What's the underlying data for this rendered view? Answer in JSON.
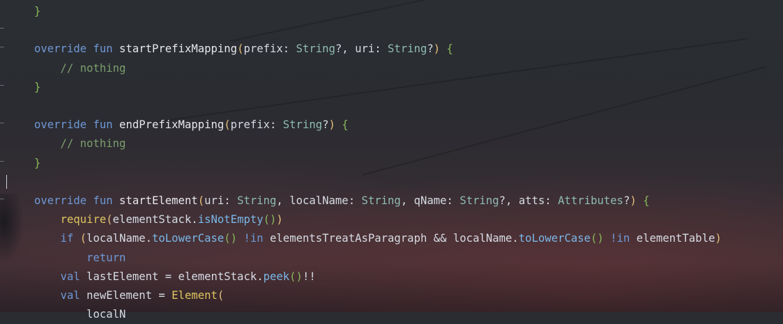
{
  "editor": {
    "lines": [
      {
        "tokens": [
          {
            "t": "}",
            "c": "brace"
          }
        ]
      },
      {
        "tokens": []
      },
      {
        "tokens": [
          {
            "t": "override",
            "c": "kw"
          },
          {
            "t": " ",
            "c": "plain"
          },
          {
            "t": "fun",
            "c": "kw"
          },
          {
            "t": " startPrefixMapping",
            "c": "fn"
          },
          {
            "t": "(",
            "c": "paren"
          },
          {
            "t": "prefix: ",
            "c": "plain"
          },
          {
            "t": "String",
            "c": "type"
          },
          {
            "t": "?, uri: ",
            "c": "plain"
          },
          {
            "t": "String",
            "c": "type"
          },
          {
            "t": "?",
            "c": "plain"
          },
          {
            "t": ")",
            "c": "paren"
          },
          {
            "t": " ",
            "c": "plain"
          },
          {
            "t": "{",
            "c": "brace"
          }
        ]
      },
      {
        "tokens": [
          {
            "t": "    // nothing",
            "c": "cmt"
          }
        ]
      },
      {
        "tokens": [
          {
            "t": "}",
            "c": "brace"
          }
        ]
      },
      {
        "tokens": []
      },
      {
        "tokens": [
          {
            "t": "override",
            "c": "kw"
          },
          {
            "t": " ",
            "c": "plain"
          },
          {
            "t": "fun",
            "c": "kw"
          },
          {
            "t": " endPrefixMapping",
            "c": "fn"
          },
          {
            "t": "(",
            "c": "paren"
          },
          {
            "t": "prefix: ",
            "c": "plain"
          },
          {
            "t": "String",
            "c": "type"
          },
          {
            "t": "?",
            "c": "plain"
          },
          {
            "t": ")",
            "c": "paren"
          },
          {
            "t": " ",
            "c": "plain"
          },
          {
            "t": "{",
            "c": "brace"
          }
        ]
      },
      {
        "tokens": [
          {
            "t": "    // nothing",
            "c": "cmt"
          }
        ]
      },
      {
        "tokens": [
          {
            "t": "}",
            "c": "brace"
          }
        ]
      },
      {
        "tokens": []
      },
      {
        "tokens": [
          {
            "t": "override",
            "c": "kw"
          },
          {
            "t": " ",
            "c": "plain"
          },
          {
            "t": "fun",
            "c": "kw"
          },
          {
            "t": " startElement",
            "c": "fn"
          },
          {
            "t": "(",
            "c": "paren"
          },
          {
            "t": "uri: ",
            "c": "plain"
          },
          {
            "t": "String",
            "c": "type"
          },
          {
            "t": ", localName: ",
            "c": "plain"
          },
          {
            "t": "String",
            "c": "type"
          },
          {
            "t": ", qName: ",
            "c": "plain"
          },
          {
            "t": "String",
            "c": "type"
          },
          {
            "t": "?, atts: ",
            "c": "plain"
          },
          {
            "t": "Attributes",
            "c": "type"
          },
          {
            "t": "?",
            "c": "plain"
          },
          {
            "t": ")",
            "c": "paren"
          },
          {
            "t": " ",
            "c": "plain"
          },
          {
            "t": "{",
            "c": "brace"
          }
        ]
      },
      {
        "tokens": [
          {
            "t": "    ",
            "c": "plain"
          },
          {
            "t": "require",
            "c": "call"
          },
          {
            "t": "(",
            "c": "paren"
          },
          {
            "t": "elementStack.",
            "c": "plain"
          },
          {
            "t": "isNotEmpty",
            "c": "mth"
          },
          {
            "t": "()",
            "c": "brace"
          },
          {
            "t": ")",
            "c": "paren"
          }
        ]
      },
      {
        "tokens": [
          {
            "t": "    ",
            "c": "plain"
          },
          {
            "t": "if",
            "c": "kw"
          },
          {
            "t": " ",
            "c": "plain"
          },
          {
            "t": "(",
            "c": "paren"
          },
          {
            "t": "localName.",
            "c": "plain"
          },
          {
            "t": "toLowerCase",
            "c": "mth"
          },
          {
            "t": "()",
            "c": "brace"
          },
          {
            "t": " ",
            "c": "plain"
          },
          {
            "t": "!in",
            "c": "kw"
          },
          {
            "t": " elementsTreatAsParagraph && localName.",
            "c": "plain"
          },
          {
            "t": "toLowerCase",
            "c": "mth"
          },
          {
            "t": "()",
            "c": "brace"
          },
          {
            "t": " ",
            "c": "plain"
          },
          {
            "t": "!in",
            "c": "kw"
          },
          {
            "t": " elementTable",
            "c": "plain"
          },
          {
            "t": ")",
            "c": "paren"
          }
        ]
      },
      {
        "tokens": [
          {
            "t": "        ",
            "c": "plain"
          },
          {
            "t": "return",
            "c": "kw"
          }
        ]
      },
      {
        "tokens": [
          {
            "t": "    ",
            "c": "plain"
          },
          {
            "t": "val",
            "c": "kw"
          },
          {
            "t": " lastElement = elementStack.",
            "c": "plain"
          },
          {
            "t": "peek",
            "c": "mth"
          },
          {
            "t": "()",
            "c": "brace"
          },
          {
            "t": "!!",
            "c": "plain"
          }
        ]
      },
      {
        "tokens": [
          {
            "t": "    ",
            "c": "plain"
          },
          {
            "t": "val",
            "c": "kw"
          },
          {
            "t": " newElement = ",
            "c": "plain"
          },
          {
            "t": "Element",
            "c": "call"
          },
          {
            "t": "(",
            "c": "paren"
          }
        ]
      },
      {
        "tokens": [
          {
            "t": "        localN",
            "c": "plain"
          }
        ]
      }
    ]
  },
  "colors": {
    "keyword": "#6f98d6",
    "type": "#8fbcb3",
    "comment": "#7b9e6d",
    "brace": "#88b85a",
    "paren": "#e5c07b",
    "method": "#7ab7e8"
  }
}
